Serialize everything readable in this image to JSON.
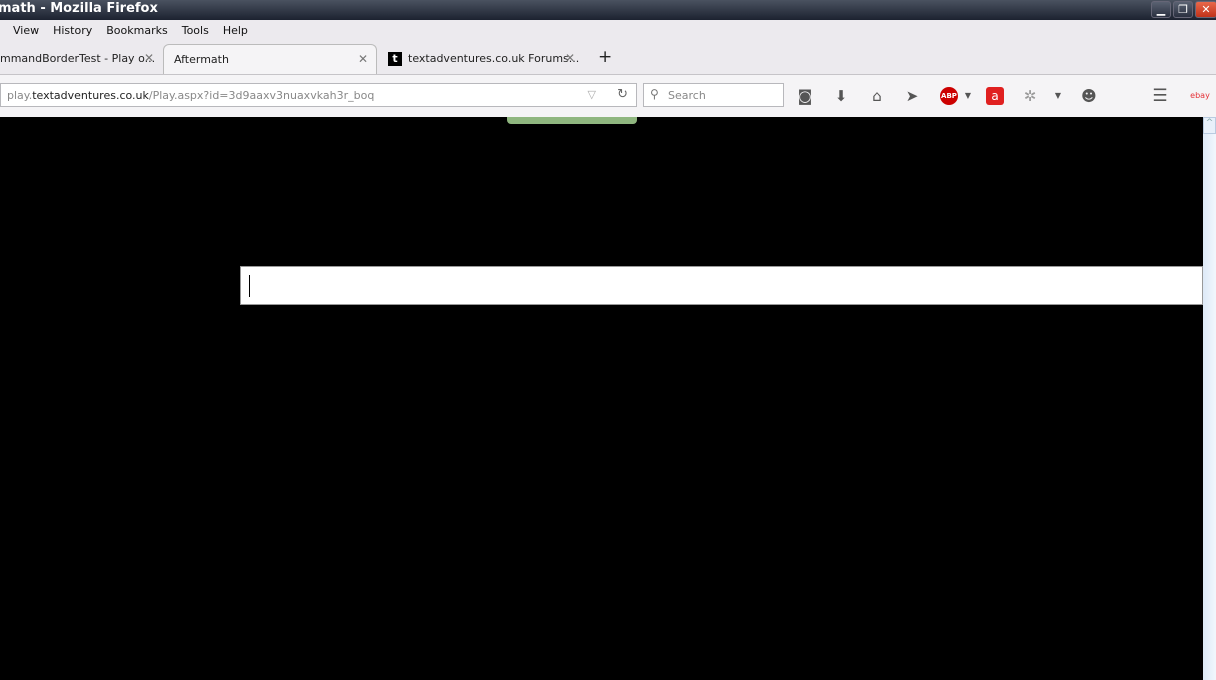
{
  "window": {
    "title": "math - Mozilla Firefox",
    "minimize": "▁",
    "restore": "❐",
    "close": "✕"
  },
  "menu": [
    "View",
    "History",
    "Bookmarks",
    "Tools",
    "Help"
  ],
  "tabs": [
    {
      "label": "mmandBorderTest - Play o...",
      "active": false
    },
    {
      "label": "Aftermath",
      "active": true
    },
    {
      "label": "textadventures.co.uk Forums...",
      "active": false,
      "favicon": "t"
    }
  ],
  "new_tab": "+",
  "url": {
    "domain_prefix": "play.",
    "domain": "textadventures.co.uk",
    "path": "/Play.aspx?id=3d9aaxv3nuaxvkah3r_boq"
  },
  "search": {
    "placeholder": "Search"
  },
  "toolbar_icons": [
    "pocket-icon",
    "download-icon",
    "home-icon",
    "send-icon",
    "adblock-plus-icon",
    "avira-icon",
    "extension-icon",
    "emoji-icon",
    "menu-icon",
    "ebay-icon"
  ],
  "abp_label": "ABP",
  "ebay_label": "ebay",
  "command_input": {
    "value": ""
  }
}
